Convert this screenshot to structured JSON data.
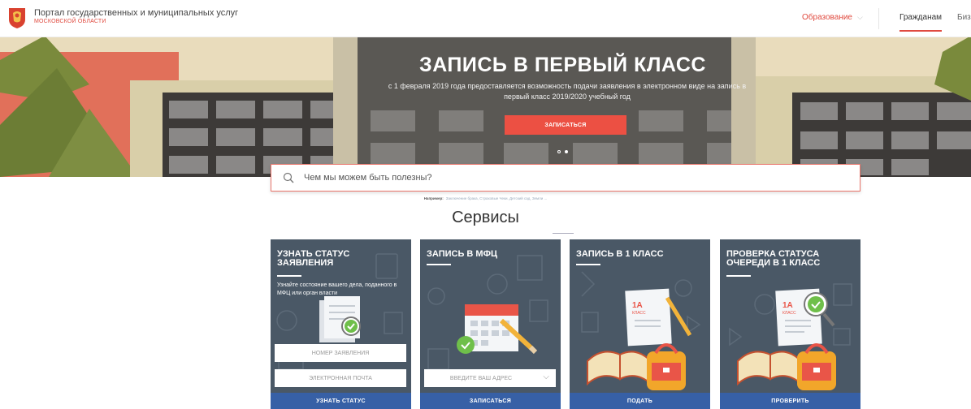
{
  "header": {
    "portal_title": "Портал государственных и муниципальных услуг",
    "portal_subtitle": "МОСКОВСКОЙ ОБЛАСТИ",
    "category": "Образование",
    "nav_citizens": "Гражданам",
    "nav_business": "Биз"
  },
  "hero": {
    "title": "ЗАПИСЬ В ПЕРВЫЙ КЛАСС",
    "subtitle": "с 1 февраля 2019 года предоставляется возможность подачи заявления в электронном виде на запись в первый класс 2019/2020 учебный год",
    "button": "ЗАПИСАТЬСЯ",
    "slides": 2,
    "active_slide": 2
  },
  "search": {
    "placeholder": "Чем мы можем быть полезны?",
    "example_label": "Например:",
    "example_links": "Заключение брака, Страховые Чеки, Детский сад, Земли ..."
  },
  "services": {
    "title": "Сервисы",
    "cards": [
      {
        "title": "УЗНАТЬ СТАТУС ЗАЯВЛЕНИЯ",
        "description": "Узнайте состояние вашего дела, поданного в МФЦ или орган власти",
        "field1": "НОМЕР ЗАЯВЛЕНИЯ",
        "field2": "ЭЛЕКТРОННАЯ ПОЧТА",
        "button": "УЗНАТЬ СТАТУС"
      },
      {
        "title": "ЗАПИСЬ В МФЦ",
        "field": "ВВЕДИТЕ ВАШ АДРЕС",
        "button": "ЗАПИСАТЬСЯ"
      },
      {
        "title": "ЗАПИСЬ В 1 КЛАСС",
        "badge_main": "1А",
        "badge_sub": "КЛАСС",
        "button": "ПОДАТЬ"
      },
      {
        "title": "ПРОВЕРКА СТАТУСА ОЧЕРЕДИ В 1 КЛАСС",
        "badge_main": "1А",
        "badge_sub": "КЛАСС",
        "button": "ПРОВЕРИТЬ"
      }
    ]
  },
  "colors": {
    "accent": "#e04a3f",
    "card_bg": "#4a5866",
    "card_button": "#3760a6",
    "hero_button": "#ec5043"
  }
}
